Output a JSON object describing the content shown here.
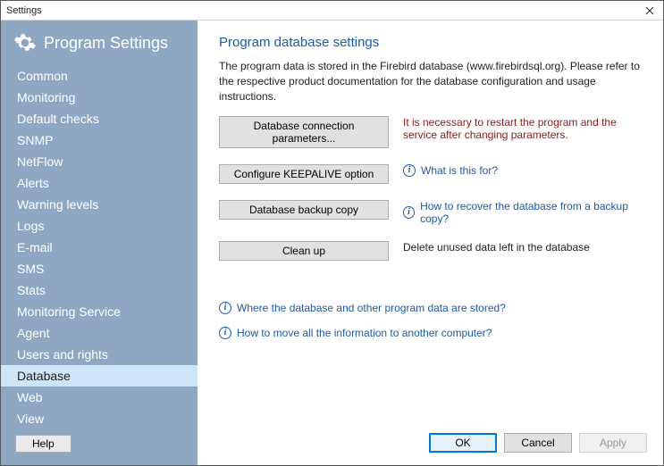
{
  "window": {
    "title": "Settings"
  },
  "sidebar": {
    "heading": "Program Settings",
    "help_label": "Help",
    "items": [
      {
        "label": "Common",
        "selected": false
      },
      {
        "label": "Monitoring",
        "selected": false
      },
      {
        "label": "Default checks",
        "selected": false
      },
      {
        "label": "SNMP",
        "selected": false
      },
      {
        "label": "NetFlow",
        "selected": false
      },
      {
        "label": "Alerts",
        "selected": false
      },
      {
        "label": "Warning levels",
        "selected": false
      },
      {
        "label": "Logs",
        "selected": false
      },
      {
        "label": "E-mail",
        "selected": false
      },
      {
        "label": "SMS",
        "selected": false
      },
      {
        "label": "Stats",
        "selected": false
      },
      {
        "label": "Monitoring Service",
        "selected": false
      },
      {
        "label": "Agent",
        "selected": false
      },
      {
        "label": "Users and rights",
        "selected": false
      },
      {
        "label": "Database",
        "selected": true
      },
      {
        "label": "Web",
        "selected": false
      },
      {
        "label": "View",
        "selected": false
      }
    ]
  },
  "main": {
    "title": "Program database settings",
    "intro": "The program data is stored in the Firebird database (www.firebirdsql.org). Please refer to the respective product documentation for the database configuration and usage instructions.",
    "rows": [
      {
        "button": "Database connection parameters...",
        "note": "It is necessary to restart the program and the service after changing parameters.",
        "note_style": "restart"
      },
      {
        "button": "Configure KEEPALIVE option",
        "link": "What is this for?"
      },
      {
        "button": "Database backup copy",
        "link": "How to recover the database from a backup copy?"
      },
      {
        "button": "Clean up",
        "note": "Delete unused data left in the database"
      }
    ],
    "help_links": [
      "Where the database and other program data are stored?",
      "How to move all the information to another computer?"
    ]
  },
  "footer": {
    "ok": "OK",
    "cancel": "Cancel",
    "apply": "Apply"
  }
}
